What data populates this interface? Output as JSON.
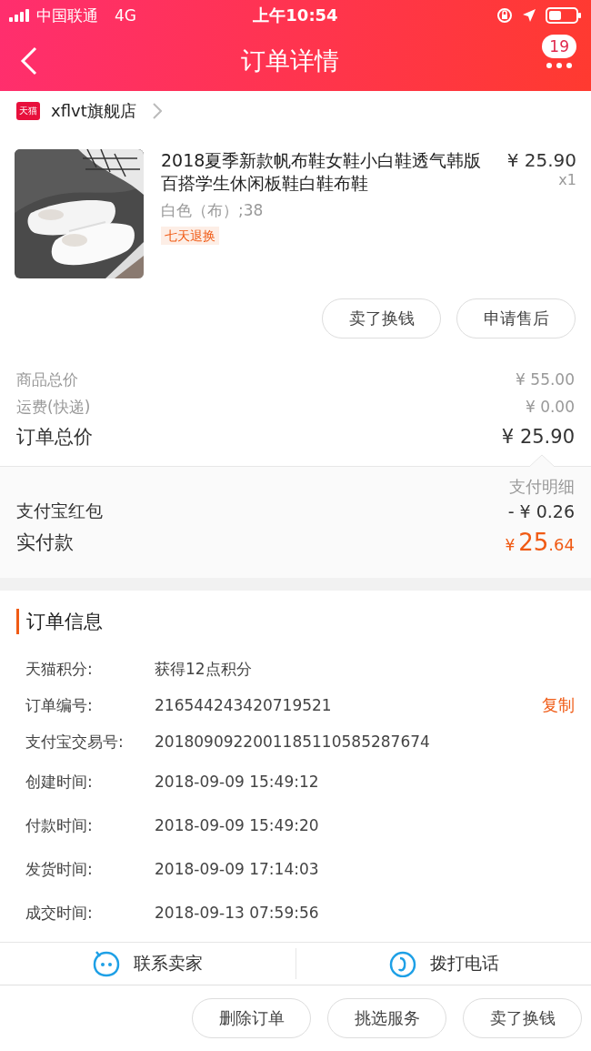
{
  "status_bar": {
    "carrier": "中国联通",
    "network": "4G",
    "time": "上午10:54"
  },
  "nav_bar": {
    "title": "订单详情",
    "badge": "19"
  },
  "shop": {
    "badge": "天猫",
    "name": "xflvt旗舰店"
  },
  "product": {
    "title": "2018夏季新款帆布鞋女鞋小白鞋透气韩版百搭学生休闲板鞋白鞋布鞋",
    "price": "¥ 25.90",
    "quantity": "x1",
    "spec": "白色（布）;38",
    "tag": "七天退换"
  },
  "item_buttons": [
    "卖了换钱",
    "申请售后"
  ],
  "price_rows": [
    {
      "label": "商品总价",
      "value": "¥ 55.00",
      "kind": "minor"
    },
    {
      "label": "运费(快递)",
      "value": "¥ 0.00",
      "kind": "minor"
    },
    {
      "label": "订单总价",
      "value": "¥ 25.90",
      "kind": "total"
    }
  ],
  "payment": {
    "detail_link": "支付明细",
    "rows": [
      {
        "label": "支付宝红包",
        "value": "- ¥ 0.26"
      }
    ],
    "paid": {
      "label": "实付款",
      "currency": "¥",
      "integer": "25",
      "decimal": ".64"
    }
  },
  "order_info": {
    "title": "订单信息",
    "rows": [
      {
        "label": "天猫积分:",
        "value": "获得12点积分"
      },
      {
        "label": "订单编号:",
        "value": "216544243420719521",
        "action": "复制"
      },
      {
        "label": "支付宝交易号:",
        "value": "2018090922001185110585287674"
      },
      {
        "label": "创建时间:",
        "value": "2018-09-09 15:49:12"
      },
      {
        "label": "付款时间:",
        "value": "2018-09-09 15:49:20"
      },
      {
        "label": "发货时间:",
        "value": "2018-09-09 17:14:03"
      },
      {
        "label": "成交时间:",
        "value": "2018-09-13 07:59:56"
      }
    ]
  },
  "contact": [
    {
      "label": "联系卖家",
      "kind": "chat"
    },
    {
      "label": "拨打电话",
      "kind": "phone"
    }
  ],
  "bottom_buttons": [
    "删除订单",
    "挑选服务",
    "卖了换钱"
  ]
}
